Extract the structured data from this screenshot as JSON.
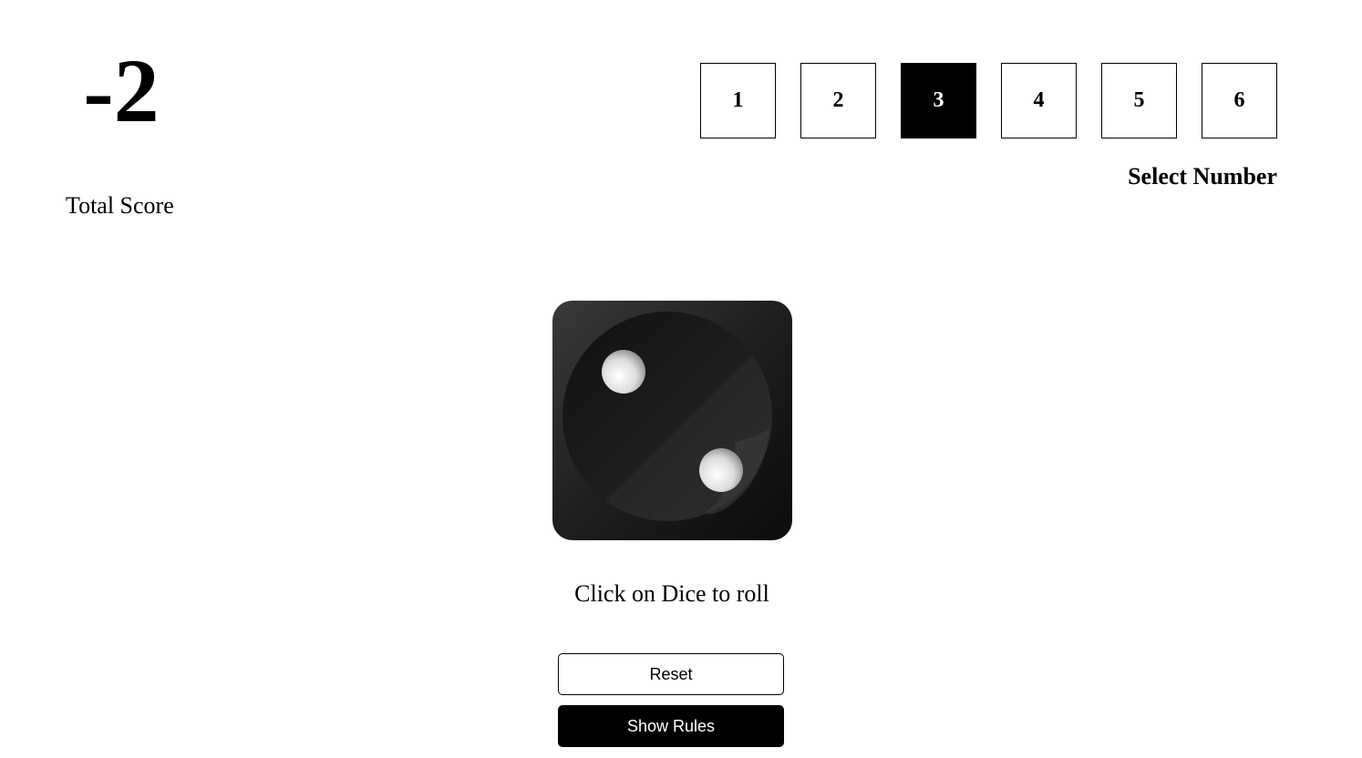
{
  "score": {
    "value": "-2",
    "label": "Total Score"
  },
  "number_select": {
    "options": [
      "1",
      "2",
      "3",
      "4",
      "5",
      "6"
    ],
    "selected": "3",
    "label": "Select Number"
  },
  "dice": {
    "face_value": 2,
    "icon": "dice-two-icon",
    "body_color": "#1c1c1c",
    "pip_color": "#e8e8e8"
  },
  "hint": "Click on Dice to roll",
  "buttons": {
    "reset_label": "Reset",
    "rules_label": "Show Rules"
  }
}
